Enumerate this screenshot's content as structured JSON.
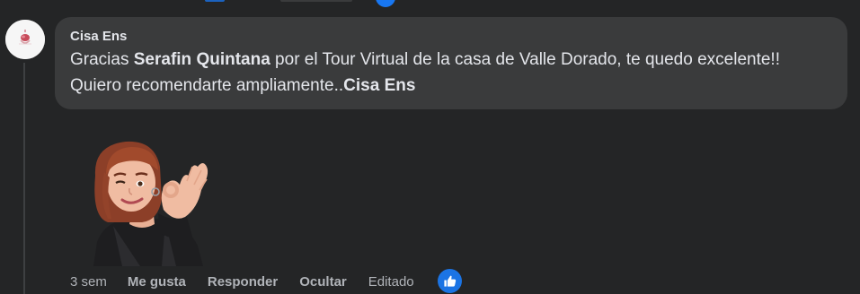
{
  "comment": {
    "author": "Cisa Ens",
    "text_parts": {
      "p1": "Gracias ",
      "mention": "Serafin Quintana",
      "p2": " por el Tour Virtual de la casa de Valle Dorado, te quedo excelente!! Quiero recomendarte ampliamente..",
      "signature": "Cisa Ens"
    },
    "sticker": "memoji-woman-ok-hand-sticker"
  },
  "actions": {
    "time": "3 sem",
    "like": "Me gusta",
    "reply": "Responder",
    "hide": "Ocultar",
    "edited": "Editado"
  },
  "reaction": {
    "icon": "thumbs-up-icon",
    "color": "#1b74e4"
  },
  "colors": {
    "background": "#242526",
    "bubble": "#3a3b3c",
    "text": "#e4e6eb",
    "secondary_text": "#b0b3b8"
  }
}
